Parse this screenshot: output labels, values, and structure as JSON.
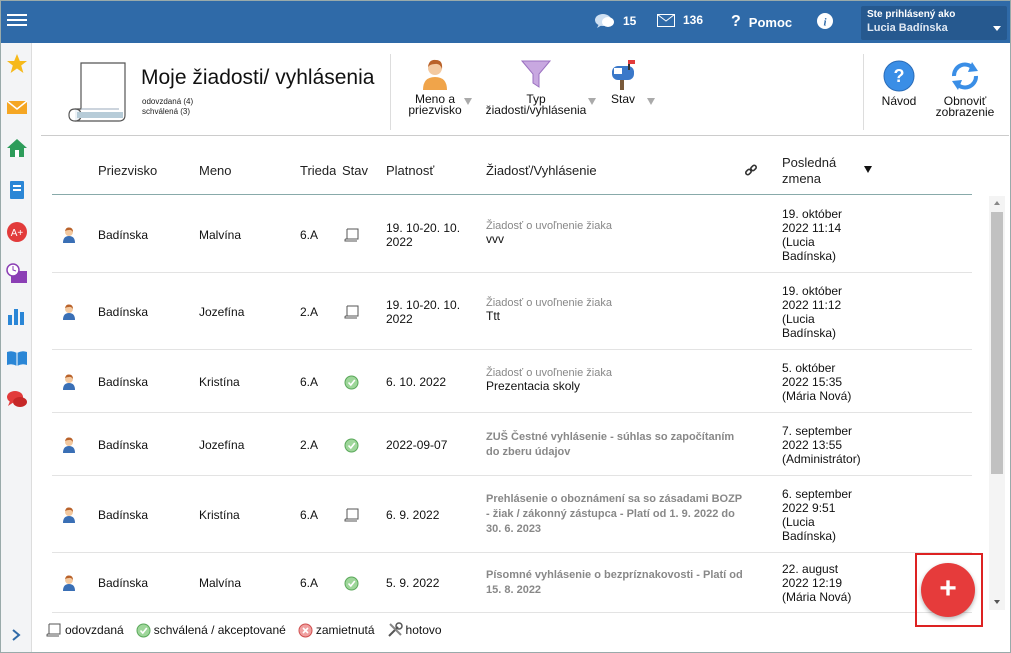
{
  "topbar": {
    "messages_count": "15",
    "mail_count": "136",
    "help_label": "Pomoc",
    "user_label": "Ste prihlásený ako",
    "user_name": "Lucia Badínska"
  },
  "header": {
    "title": "Moje žiadosti/ vyhlásenia",
    "count_sent": "odovzdaná (4)",
    "count_approved": "schválená (3)",
    "filter_name": "Meno a\npriezvisko",
    "filter_type": "Typ\nžiadosti/vyhlásenia",
    "filter_state": "Stav",
    "help_button": "Návod",
    "refresh_button": "Obnoviť\nzobrazenie"
  },
  "table": {
    "headers": {
      "surname": "Priezvisko",
      "name": "Meno",
      "class": "Trieda",
      "state": "Stav",
      "validity": "Platnosť",
      "request": "Žiadosť/Vyhlásenie",
      "last_change": "Posledná\nzmena"
    },
    "rows": [
      {
        "surname": "Badínska",
        "name": "Malvína",
        "class": "6.A",
        "state": "odovzdaná",
        "validity": "19. 10-20. 10.\n2022",
        "type": "Žiadosť o uvoľnenie žiaka",
        "text": "vvv",
        "last": "19. október\n2022 11:14\n(Lucia\nBadínska)"
      },
      {
        "surname": "Badínska",
        "name": "Jozefína",
        "class": "2.A",
        "state": "odovzdaná",
        "validity": "19. 10-20. 10.\n2022",
        "type": "Žiadosť o uvoľnenie žiaka",
        "text": "Ttt",
        "last": "19. október\n2022 11:12\n(Lucia\nBadínska)"
      },
      {
        "surname": "Badínska",
        "name": "Kristína",
        "class": "6.A",
        "state": "schválená",
        "validity": "6. 10. 2022",
        "type": "Žiadosť o uvoľnenie žiaka",
        "text": "Prezentacia skoly",
        "last": "5. október\n2022 15:35\n(Mária Nová)"
      },
      {
        "surname": "Badínska",
        "name": "Jozefína",
        "class": "2.A",
        "state": "schválená",
        "validity": "2022-09-07",
        "type": "ZUŠ Čestné vyhlásenie - súhlas so započítaním\ndo zberu údajov",
        "text": "",
        "last": "7. september\n2022 13:55\n(Administrátor)"
      },
      {
        "surname": "Badínska",
        "name": "Kristína",
        "class": "6.A",
        "state": "odovzdaná",
        "validity": "6. 9. 2022",
        "type": "Prehlásenie o oboznámení sa so zásadami BOZP\n- žiak / zákonný zástupca - Platí od 1. 9. 2022 do\n30. 6. 2023",
        "text": "",
        "last": "6. september\n2022 9:51\n(Lucia\nBadínska)"
      },
      {
        "surname": "Badínska",
        "name": "Malvína",
        "class": "6.A",
        "state": "schválená",
        "validity": "5. 9. 2022",
        "type": "Písomné vyhlásenie o bezpríznakovosti - Platí od\n15. 8. 2022",
        "text": "",
        "last": "22. august\n2022 12:19\n(Mária Nová)"
      }
    ]
  },
  "legend": {
    "sent": "odovzdaná",
    "approved": "schválená / akceptované",
    "rejected": "zamietnutá",
    "done": "hotovo"
  },
  "fab_label": "+"
}
